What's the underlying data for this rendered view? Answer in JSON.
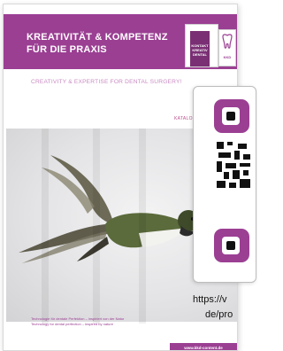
{
  "catalog": {
    "headline_line1": "KREATIVITÄT & KOMPETENZ",
    "headline_line2": "FÜR DIE PRAXIS",
    "tagline": "CREATIVITY & EXPERTISE FOR DENTAL SURGERY!",
    "katalog_label": "KATALO",
    "footer_de": "Technologie für dentale Perfektion – inspiriert von der Natur",
    "footer_en": "Technology for dental perfection – inspired by nature",
    "footer_url": "www.kkd-content.de",
    "logo_text": "KKD",
    "logo_dark_text": "KONTAKT KREATIV DENTAL"
  },
  "qr_overlay": {
    "url_line1": "https://v",
    "url_line2": "de/pro"
  },
  "colors": {
    "brand_purple": "#9b3f93",
    "tagline_pink": "#c98cc3"
  }
}
